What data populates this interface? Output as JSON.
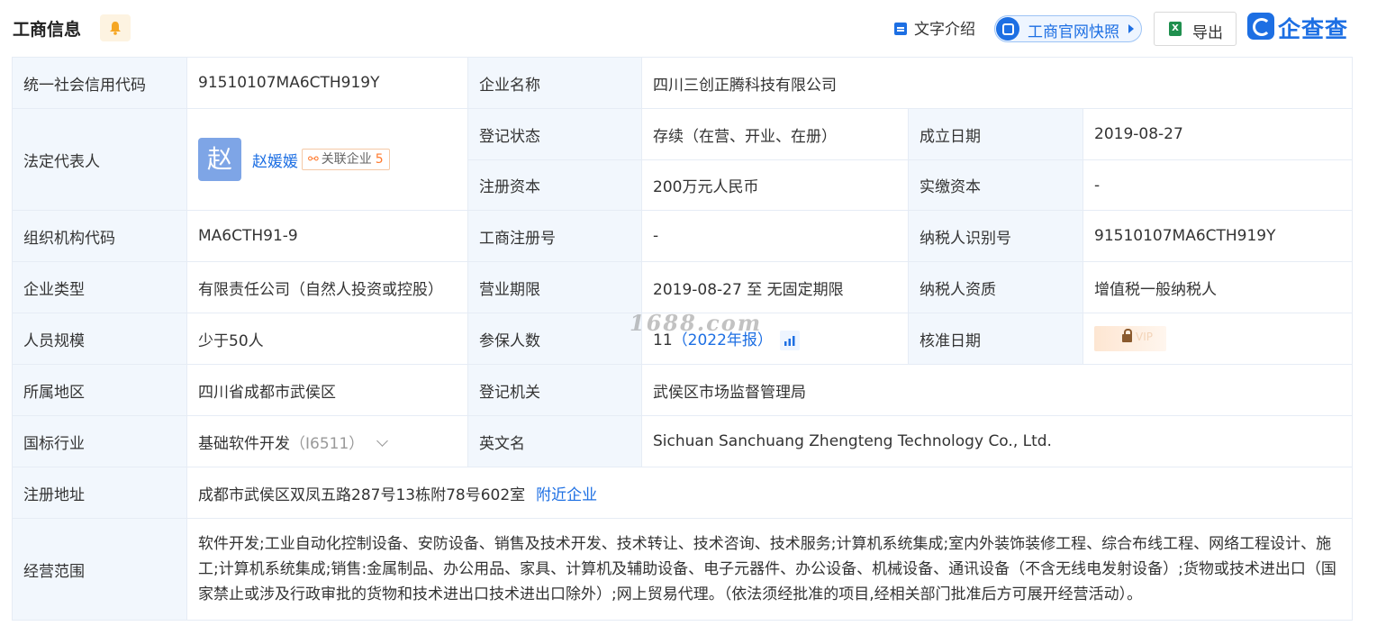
{
  "header": {
    "title": "工商信息",
    "text_intro": "文字介绍",
    "snapshot": "工商官网快照",
    "export": "导出",
    "export_icon": "X",
    "logo": "企查查"
  },
  "colors": {
    "accent": "#1d6fe3",
    "label_bg": "#f2f7fd",
    "orange": "#ff7a2e"
  },
  "rows": {
    "credit_code": {
      "label": "统一社会信用代码",
      "value": "91510107MA6CTH919Y"
    },
    "company_name": {
      "label": "企业名称",
      "value": "四川三创正腾科技有限公司"
    },
    "legal_rep": {
      "label": "法定代表人",
      "avatar": "赵",
      "name": "赵媛媛",
      "related": "关联企业",
      "related_count": "5"
    },
    "reg_status": {
      "label": "登记状态",
      "value": "存续（在营、开业、在册）"
    },
    "found_date": {
      "label": "成立日期",
      "value": "2019-08-27"
    },
    "reg_capital": {
      "label": "注册资本",
      "value": "200万元人民币"
    },
    "paid_capital": {
      "label": "实缴资本",
      "value": "-"
    },
    "org_code": {
      "label": "组织机构代码",
      "value": "MA6CTH91-9"
    },
    "biz_reg_no": {
      "label": "工商注册号",
      "value": "-"
    },
    "taxpayer_id": {
      "label": "纳税人识别号",
      "value": "91510107MA6CTH919Y"
    },
    "company_type": {
      "label": "企业类型",
      "value": "有限责任公司（自然人投资或控股）"
    },
    "biz_term": {
      "label": "营业期限",
      "value": "2019-08-27 至 无固定期限"
    },
    "taxpayer_qual": {
      "label": "纳税人资质",
      "value": "增值税一般纳税人"
    },
    "staff_size": {
      "label": "人员规模",
      "value": "少于50人"
    },
    "insured": {
      "label": "参保人数",
      "value": "11",
      "report": "（2022年报）"
    },
    "approve_date": {
      "label": "核准日期",
      "vip": "VIP"
    },
    "region": {
      "label": "所属地区",
      "value": "四川省成都市武侯区"
    },
    "reg_authority": {
      "label": "登记机关",
      "value": "武侯区市场监督管理局"
    },
    "industry": {
      "label": "国标行业",
      "value": "基础软件开发",
      "code": "（I6511）"
    },
    "english_name": {
      "label": "英文名",
      "value": "Sichuan Sanchuang Zhengteng Technology Co., Ltd."
    },
    "reg_address": {
      "label": "注册地址",
      "value": "成都市武侯区双凤五路287号13栋附78号602室",
      "nearby": "附近企业"
    },
    "scope": {
      "label": "经营范围",
      "value": "软件开发;工业自动化控制设备、安防设备、销售及技术开发、技术转让、技术咨询、技术服务;计算机系统集成;室内外装饰装修工程、综合布线工程、网络工程设计、施工;计算机系统集成;销售:金属制品、办公用品、家具、计算机及辅助设备、电子元器件、办公设备、机械设备、通讯设备（不含无线电发射设备）;货物或技术进出口（国家禁止或涉及行政审批的货物和技术进出口技术进出口除外）;网上贸易代理。（依法须经批准的项目,经相关部门批准后方可展开经营活动）。"
    }
  },
  "watermark": "1688.com"
}
